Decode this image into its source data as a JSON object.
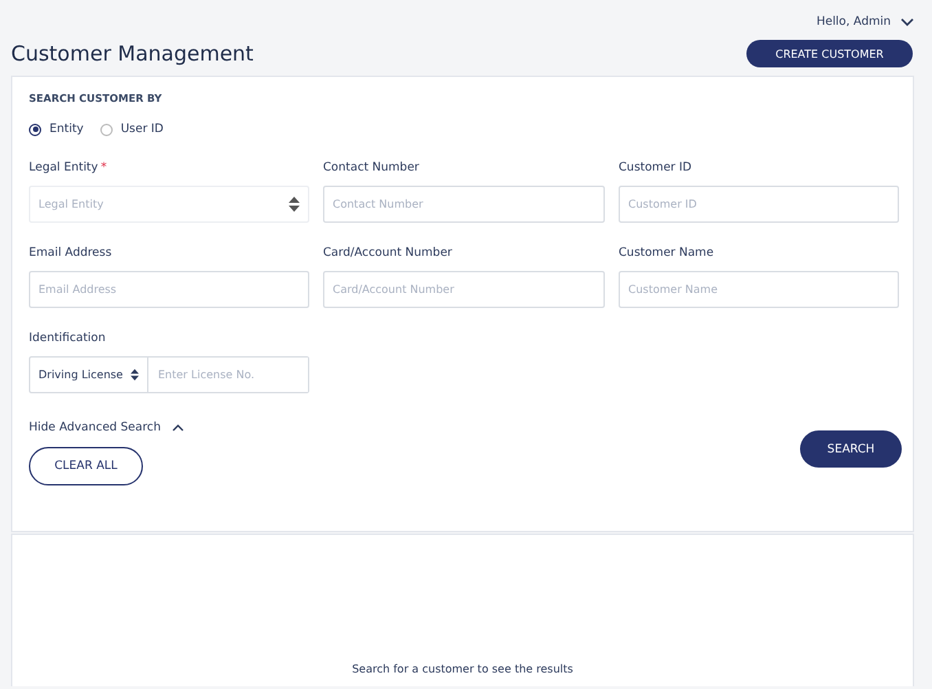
{
  "user_menu": {
    "label": "Hello, Admin"
  },
  "title": "Customer Management",
  "create_button": "CREATE CUSTOMER",
  "search": {
    "heading": "SEARCH CUSTOMER BY",
    "modes": [
      {
        "label": "Entity",
        "selected": true
      },
      {
        "label": "User ID",
        "selected": false
      }
    ],
    "fields": [
      {
        "label": "Legal Entity",
        "required_mark": "*",
        "kind": "select",
        "placeholder": "Legal Entity"
      },
      {
        "label": "Contact Number",
        "kind": "text",
        "placeholder": "Contact Number"
      },
      {
        "label": "Customer ID",
        "kind": "text",
        "placeholder": "Customer ID"
      },
      {
        "label": "Email Address",
        "kind": "text",
        "placeholder": "Email Address"
      },
      {
        "label": "Card/Account Number",
        "kind": "text",
        "placeholder": "Card/Account Number"
      },
      {
        "label": "Customer Name",
        "kind": "text",
        "placeholder": "Customer Name"
      }
    ],
    "identification": {
      "label": "Identification",
      "type_value": "Driving License",
      "placeholder": "Enter License No."
    },
    "advanced_toggle": {
      "label": "Hide Advanced Search",
      "expanded": true
    },
    "clear_button": "CLEAR ALL",
    "search_button": "SEARCH"
  },
  "results": {
    "empty_message": "Search for a customer to see the results"
  }
}
